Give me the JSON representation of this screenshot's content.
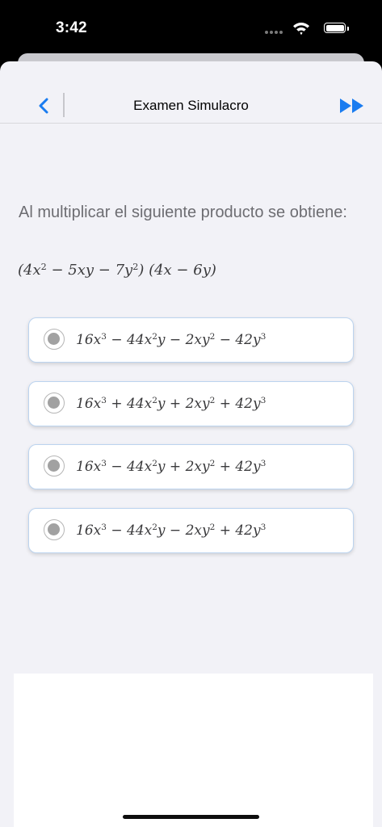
{
  "status_bar": {
    "time": "3:42",
    "icons": [
      "signal-dots-icon",
      "wifi-icon",
      "battery-icon"
    ]
  },
  "nav": {
    "title": "Examen Simulacro",
    "back_icon": "chevron-left-icon",
    "forward_icon": "fast-forward-icon",
    "accent_color": "#1a7cf0"
  },
  "question": {
    "text": "Al multiplicar el siguiente producto se obtiene:",
    "expression_html": "(4<i>x</i><sup>2</sup> − 5<i>xy</i> − 7<i>y</i><sup>2</sup>) (4<i>x</i> − 6<i>y</i>)"
  },
  "options": [
    {
      "expression_html": "16<i>x</i><sup>3</sup> − 44<i>x</i><sup>2</sup><i>y</i> − 2<i>xy</i><sup>2</sup> − 42<i>y</i><sup>3</sup>"
    },
    {
      "expression_html": "16<i>x</i><sup>3</sup> + 44<i>x</i><sup>2</sup><i>y</i> + 2<i>xy</i><sup>2</sup> + 42<i>y</i><sup>3</sup>"
    },
    {
      "expression_html": "16<i>x</i><sup>3</sup> − 44<i>x</i><sup>2</sup><i>y</i> + 2<i>xy</i><sup>2</sup> + 42<i>y</i><sup>3</sup>"
    },
    {
      "expression_html": "16<i>x</i><sup>3</sup> − 44<i>x</i><sup>2</sup><i>y</i> − 2<i>xy</i><sup>2</sup> + 42<i>y</i><sup>3</sup>"
    }
  ],
  "colors": {
    "option_border": "#bcd4ef",
    "radio_fill": "#a1a1a1",
    "background": "#f2f2f7"
  }
}
